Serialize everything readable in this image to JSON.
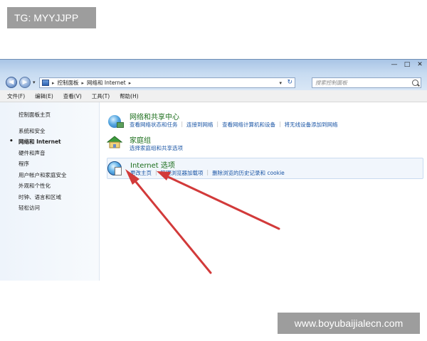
{
  "watermarks": {
    "top": "TG: MYYJJPP",
    "bottom": "www.boyubaijialecn.com"
  },
  "window": {
    "controls": {
      "minimize": "—",
      "maximize": "□",
      "close": "✕"
    },
    "nav": {
      "back": "◀",
      "forward": "▶",
      "dropdown": "▾"
    },
    "address": {
      "crumbs": [
        "控制面板",
        "网络和 Internet"
      ],
      "sep": "▸",
      "dropdown": "▾",
      "refresh": "↻"
    },
    "search": {
      "placeholder": "搜索控制面板"
    }
  },
  "menubar": {
    "items": [
      "文件(F)",
      "编辑(E)",
      "查看(V)",
      "工具(T)",
      "帮助(H)"
    ]
  },
  "sidebar": {
    "items": [
      "控制面板主页",
      "系统和安全",
      "网络和 Internet",
      "硬件和声音",
      "程序",
      "用户帐户和家庭安全",
      "外观和个性化",
      "时钟、语言和区域",
      "轻松访问"
    ],
    "active_index": 2
  },
  "categories": [
    {
      "title": "网络和共享中心",
      "links": [
        "查看网络状态和任务",
        "连接到网络",
        "查看网络计算机和设备",
        "将无线设备添加到网络"
      ]
    },
    {
      "title": "家庭组",
      "links": [
        "选择家庭组和共享选项"
      ]
    },
    {
      "title": "Internet 选项",
      "links": [
        "更改主页",
        "管理浏览器加载项",
        "删除浏览的历史记录和 cookie"
      ]
    }
  ],
  "colors": {
    "link": "#1a55a5",
    "title": "#1c6e1c",
    "arrow": "#d23a3a",
    "titlebar": "#c7dbf1"
  },
  "icons": {
    "network": "network-globe-icon",
    "homegroup": "homegroup-icon",
    "internet": "internet-options-icon"
  }
}
